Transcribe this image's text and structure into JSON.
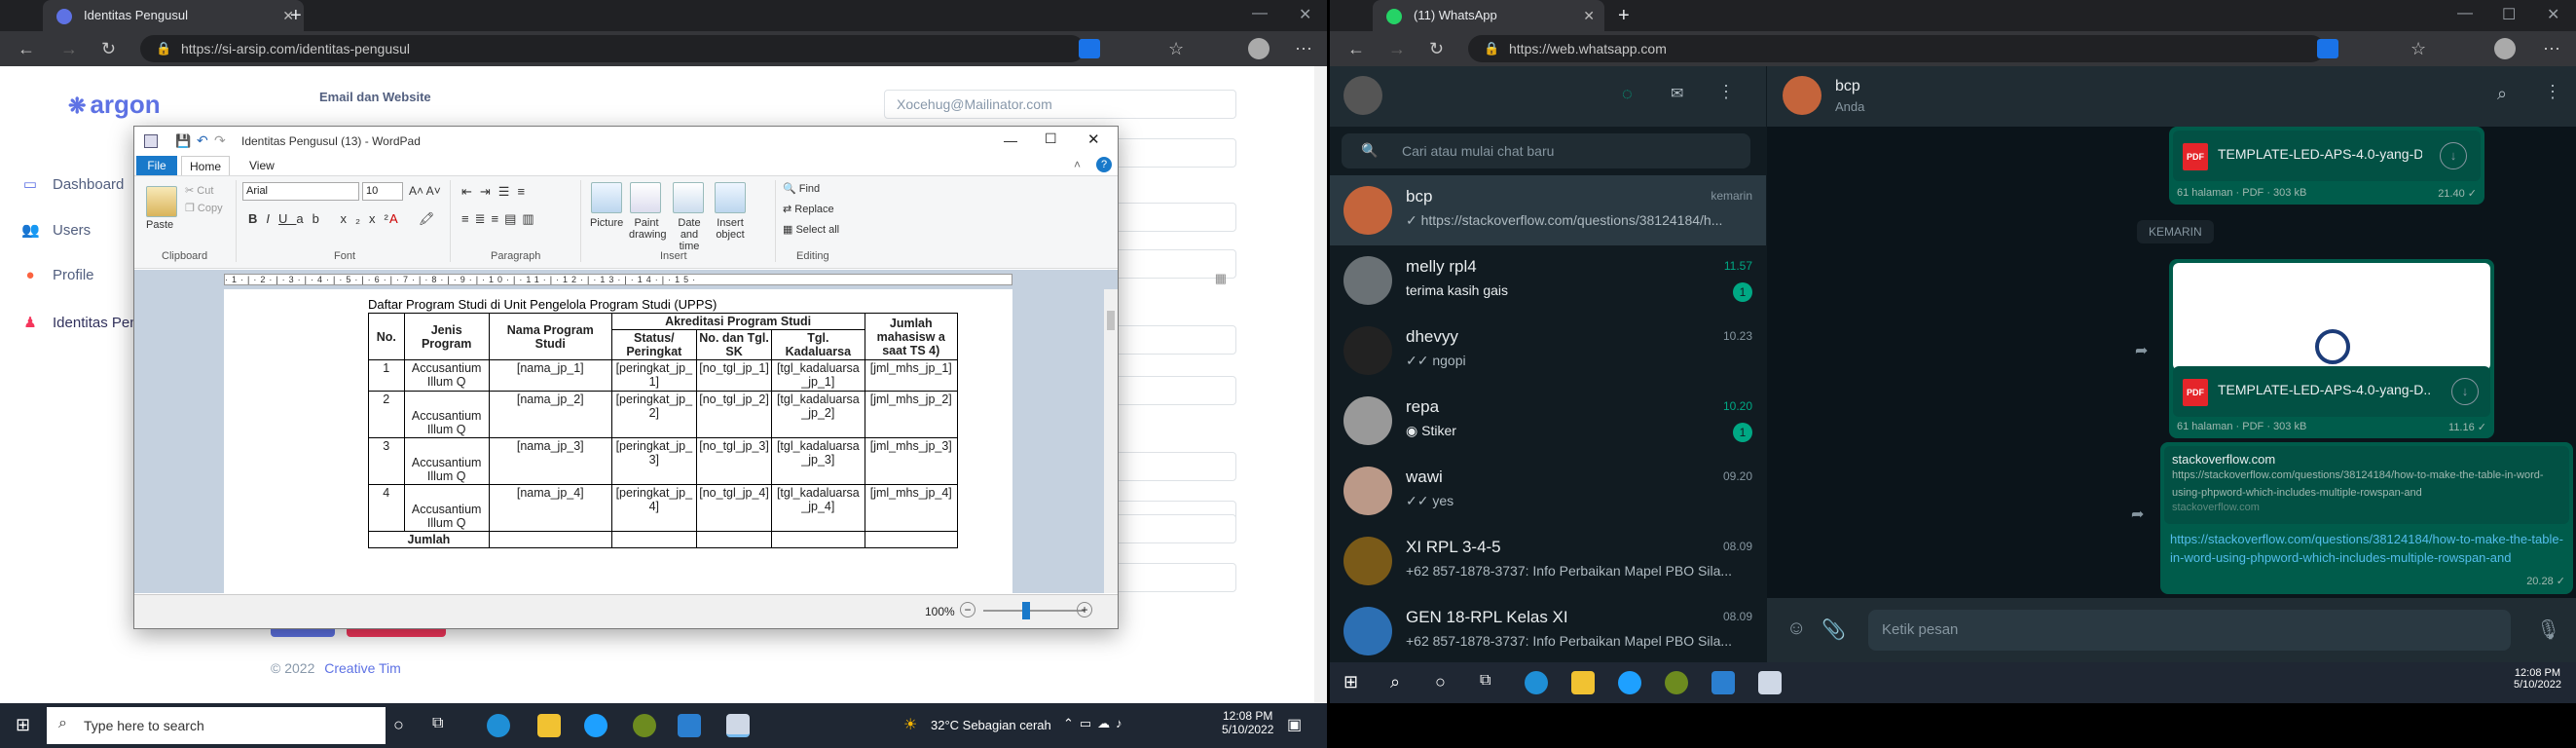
{
  "left_browser": {
    "tab_title": "Identitas Pengusul",
    "url": "https://si-arsip.com/identitas-pengusul",
    "app_logo": "argon",
    "sidebar": [
      {
        "label": "Dashboard",
        "icon": "monitor-icon"
      },
      {
        "label": "Users",
        "icon": "users-icon"
      },
      {
        "label": "Profile",
        "icon": "user-icon"
      },
      {
        "label": "Identitas Pen",
        "icon": "person-icon"
      }
    ],
    "email_label": "Email dan Website",
    "email_value": "Xocehug@Mailinator.com",
    "footer_year": "© 2022",
    "footer_link": "Creative Tim"
  },
  "wordpad": {
    "title": "Identitas Pengusul (13) - WordPad",
    "tabs": [
      "File",
      "Home",
      "View"
    ],
    "clipboard": {
      "paste": "Paste",
      "cut": "Cut",
      "copy": "Copy",
      "group": "Clipboard"
    },
    "font": {
      "family": "Arial",
      "size": "10",
      "group": "Font"
    },
    "paragraph_group": "Paragraph",
    "insert": {
      "picture": "Picture",
      "paint": "Paint drawing",
      "date": "Date and time",
      "object": "Insert object",
      "group": "Insert"
    },
    "editing": {
      "find": "Find",
      "replace": "Replace",
      "select_all": "Select all",
      "group": "Editing"
    },
    "zoom": "100%",
    "doc_title": "Daftar Program Studi di Unit Pengelola Program Studi (UPPS)",
    "table": {
      "h_no": "No.",
      "h_jenis": "Jenis Program",
      "h_nama": "Nama Program Studi",
      "h_akreditasi": "Akreditasi Program Studi",
      "h_status": "Status/ Peringkat",
      "h_sk": "No. dan Tgl. SK",
      "h_tgl": "Tgl. Kadaluarsa",
      "h_jumlah": "Jumlah mahasisw a saat TS 4)",
      "rows": [
        {
          "no": "1",
          "jenis": "Accusantium Illum Q",
          "nama": "[nama_jp_1]",
          "status": "[peringkat_jp_1]",
          "sk": "[no_tgl_jp_1]",
          "tgl": "[tgl_kadaluarsa_jp_1]",
          "jml": "[jml_mhs_jp_1]"
        },
        {
          "no": "2",
          "jenis": "Accusantium Illum Q",
          "nama": "[nama_jp_2]",
          "status": "[peringkat_jp_2]",
          "sk": "[no_tgl_jp_2]",
          "tgl": "[tgl_kadaluarsa_jp_2]",
          "jml": "[jml_mhs_jp_2]"
        },
        {
          "no": "3",
          "jenis": "Accusantium Illum Q",
          "nama": "[nama_jp_3]",
          "status": "[peringkat_jp_3]",
          "sk": "[no_tgl_jp_3]",
          "tgl": "[tgl_kadaluarsa_jp_3]",
          "jml": "[jml_mhs_jp_3]"
        },
        {
          "no": "4",
          "jenis": "Accusantium Illum Q",
          "nama": "[nama_jp_4]",
          "status": "[peringkat_jp_4]",
          "sk": "[no_tgl_jp_4]",
          "tgl": "[tgl_kadaluarsa_jp_4]",
          "jml": "[jml_mhs_jp_4]"
        }
      ],
      "footer": "Jumlah"
    }
  },
  "right_browser": {
    "tab_title": "(11) WhatsApp",
    "url": "https://web.whatsapp.com",
    "search_placeholder": "Cari atau mulai chat baru",
    "chats": [
      {
        "name": "bcp",
        "time": "kemarin",
        "preview": "✓ https://stackoverflow.com/questions/38124184/h...",
        "badge": ""
      },
      {
        "name": "melly rpl4",
        "time": "11.57",
        "preview": "terima kasih gais",
        "badge": "1"
      },
      {
        "name": "dhevyy",
        "time": "10.23",
        "preview": "✓✓ ngopi",
        "badge": ""
      },
      {
        "name": "repa",
        "time": "10.20",
        "preview": "Stiker",
        "badge": "1"
      },
      {
        "name": "wawi",
        "time": "09.20",
        "preview": "✓✓ yes",
        "badge": ""
      },
      {
        "name": "XI RPL 3-4-5",
        "time": "08.09",
        "preview": "+62 857-1878-3737: Info Perbaikan Mapel PBO Sila...",
        "badge": ""
      },
      {
        "name": "GEN 18-RPL Kelas XI",
        "time": "08.09",
        "preview": "+62 857-1878-3737: Info Perbaikan Mapel PBO Sila...",
        "badge": ""
      }
    ],
    "conv_name": "bcp",
    "conv_status": "Anda",
    "file1": {
      "name": "TEMPLATE-LED-APS-4.0-yang-D...",
      "meta": "61 halaman · PDF · 303 kB",
      "time": "21.40 ✓"
    },
    "date_divider": "KEMARIN",
    "file2": {
      "name": "TEMPLATE-LED-APS-4.0-yang-D...",
      "meta": "61 halaman · PDF · 303 kB",
      "time": "11.16 ✓"
    },
    "link_msg": {
      "site": "stackoverflow.com",
      "desc": "https://stackoverflow.com/questions/38124184/how-to-make-the-table-in-word-using-phpword-which-includes-multiple-rowspan-and",
      "domain": "stackoverflow.com",
      "url": "https://stackoverflow.com/questions/38124184/how-to-make-the-table-in-word-using-phpword-which-includes-multiple-rowspan-and",
      "time": "20.28 ✓"
    },
    "compose_placeholder": "Ketik pesan"
  },
  "taskbar_left": {
    "search_placeholder": "Type here to search",
    "weather": "32°C Sebagian cerah",
    "time": "12:08 PM",
    "date": "5/10/2022"
  },
  "taskbar_right": {
    "time": "12:08 PM",
    "date": "5/10/2022"
  }
}
